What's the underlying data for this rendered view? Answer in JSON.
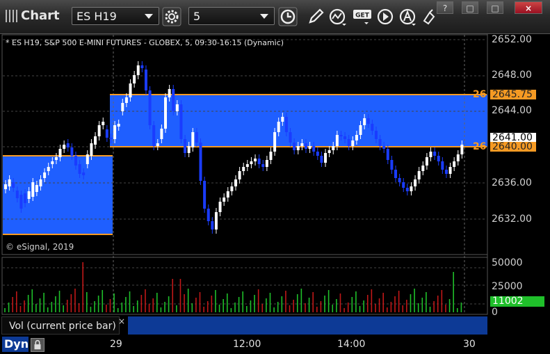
{
  "toolbar": {
    "app_title": "Chart",
    "symbol": "ES H19",
    "interval": "5",
    "window_buttons": [
      "?",
      "□",
      "□",
      "×"
    ],
    "icons": [
      "gear-icon",
      "clock-icon",
      "pencil-icon",
      "line-study-icon",
      "get-data-icon",
      "play-icon",
      "alert-icon",
      "cursor-icon"
    ]
  },
  "chart": {
    "header": "* ES H19, S&P 500 E-MINI FUTURES - GLOBEX, 5, 09:30-16:15 (Dynamic)",
    "copyright": "© eSignal, 2019",
    "price_axis": [
      "2652.00",
      "2648.00",
      "2644.00",
      "2640.00",
      "2636.00",
      "2632.00"
    ],
    "levels": {
      "upper": "2645.75",
      "lower": "2640.00",
      "last": "2641.00",
      "truncated_prefix": "26"
    },
    "colors": {
      "band": "#1f5fff",
      "level_line": "#f59a23",
      "up_candle": "#ffffff",
      "down_candle": "#1a3cff",
      "vol_up": "#1fbf2a",
      "vol_down": "#c01818"
    }
  },
  "volume": {
    "axis": [
      "50000",
      "25000",
      "0"
    ],
    "last": "11002",
    "study_label": "Vol (current price bar)",
    "close_glyph": "×"
  },
  "time_axis": {
    "mode_label": "Dyn",
    "labels": [
      "29",
      "12:00",
      "14:00",
      "30"
    ]
  }
}
